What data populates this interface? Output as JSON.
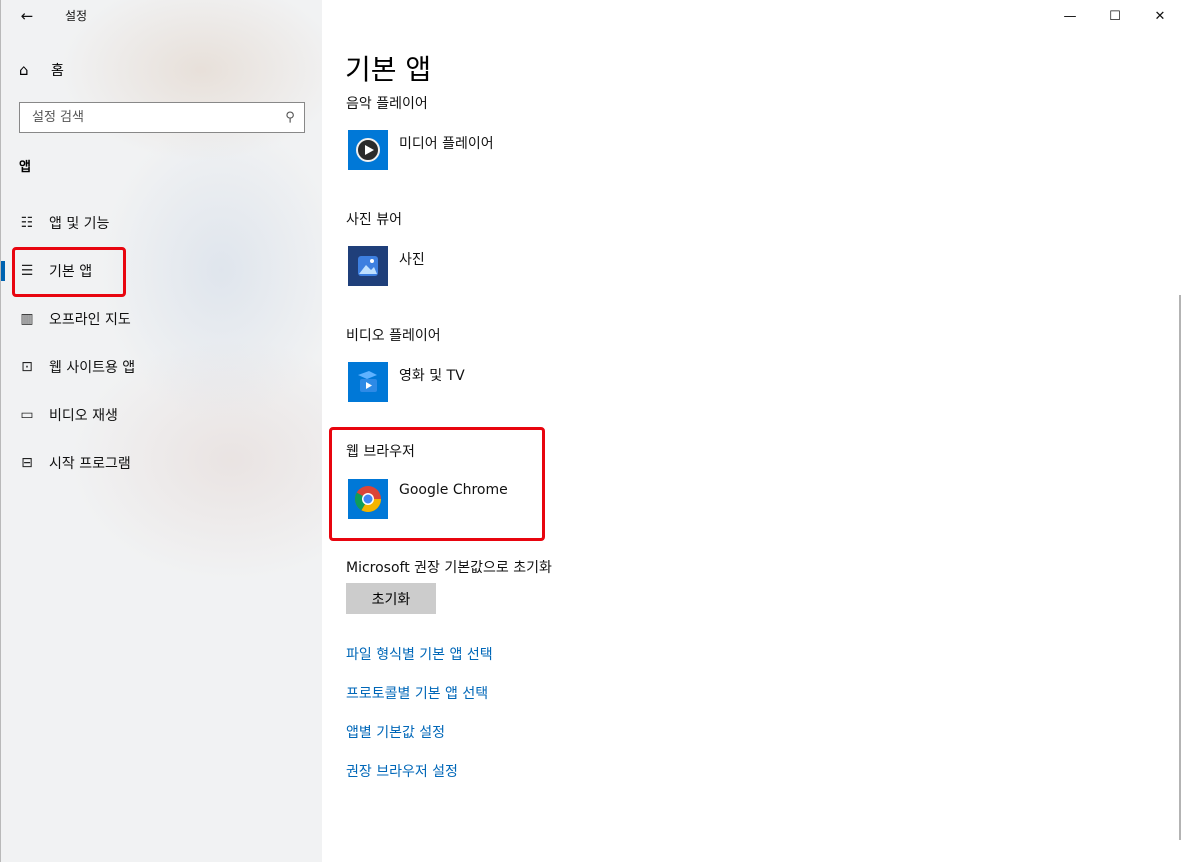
{
  "window": {
    "title": "설정",
    "back_icon": "←",
    "minimize_icon": "—",
    "maximize_icon": "☐",
    "close_icon": "✕"
  },
  "sidebar": {
    "home_icon": "⌂",
    "home_label": "홈",
    "search_placeholder": "설정 검색",
    "search_icon": "⚲",
    "section": "앱",
    "items": [
      {
        "icon": "☷",
        "label": "앱 및 기능",
        "active": false
      },
      {
        "icon": "☰",
        "label": "기본 앱",
        "active": true
      },
      {
        "icon": "▥",
        "label": "오프라인 지도",
        "active": false
      },
      {
        "icon": "⊡",
        "label": "웹 사이트용 앱",
        "active": false
      },
      {
        "icon": "▭",
        "label": "비디오 재생",
        "active": false
      },
      {
        "icon": "⊟",
        "label": "시작 프로그램",
        "active": false
      }
    ]
  },
  "main": {
    "title": "기본 앱",
    "categories": [
      {
        "label": "음악 플레이어",
        "app": "미디어 플레이어",
        "icon": "media-player-icon"
      },
      {
        "label": "사진 뷰어",
        "app": "사진",
        "icon": "photos-icon"
      },
      {
        "label": "비디오 플레이어",
        "app": "영화 및 TV",
        "icon": "movies-tv-icon"
      },
      {
        "label": "웹 브라우저",
        "app": "Google Chrome",
        "icon": "chrome-icon"
      }
    ],
    "reset_label": "Microsoft 권장 기본값으로 초기화",
    "reset_button": "초기화",
    "links": [
      "파일 형식별 기본 앱 선택",
      "프로토콜별 기본 앱 선택",
      "앱별 기본값 설정",
      "권장 브라우저 설정"
    ]
  },
  "colors": {
    "accent": "#0078d7",
    "link": "#0067b8",
    "highlight": "#e8050f"
  }
}
